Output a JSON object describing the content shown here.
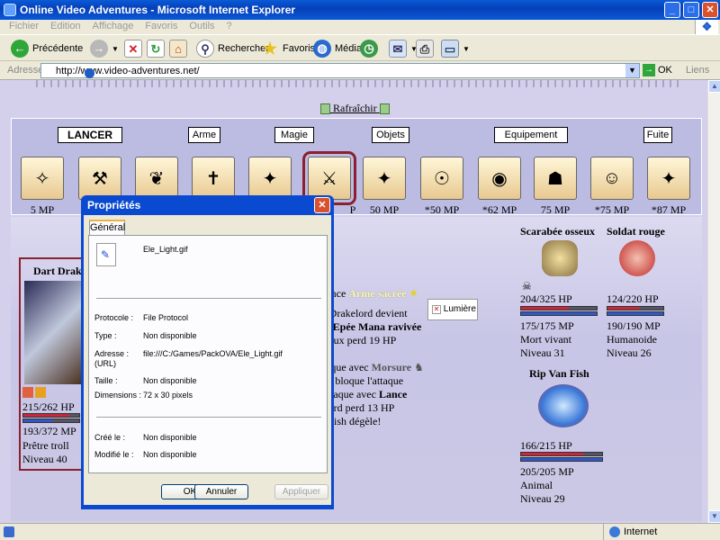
{
  "window": {
    "title": "Online Video Adventures - Microsoft Internet Explorer",
    "min": "_",
    "max": "□",
    "close": "✕"
  },
  "menu": [
    "Fichier",
    "Edition",
    "Affichage",
    "Favoris",
    "Outils",
    "?"
  ],
  "toolbar": {
    "back": "Précédente",
    "search": "Rechercher",
    "favorites": "Favoris",
    "media": "Média"
  },
  "address": {
    "label": "Adresse",
    "url": "http://www.video-adventures.net/",
    "go": "OK",
    "links": "Liens"
  },
  "status": {
    "zone": "Internet"
  },
  "page": {
    "refresh": "Rafraîchir",
    "actions": [
      "LANCER",
      "Arme",
      "Magie",
      "Objets",
      "Equipement",
      "Fuite"
    ],
    "spell_costs": [
      "5 MP",
      "",
      "",
      "",
      "",
      "",
      "50 MP",
      "*50 MP",
      "*62 MP",
      "75 MP",
      "*75 MP",
      "*87 MP"
    ],
    "selected_spell_cost_suffix": "P",
    "spell_icons": [
      "✧",
      "⚒",
      "❦",
      "✝",
      "✦",
      "⚔",
      "✦",
      "☉",
      "◉",
      "☗",
      "☺",
      "✦"
    ],
    "selected_spell": 5,
    "log": {
      "line1_pre": "d lance ",
      "line1_spell": "Arme sacrée",
      "line2": "art Drakelord devient",
      "line3_pre": "vec ",
      "line3_status": "Epée Mana ravivée",
      "line4": "osseux perd 19 HP",
      "line5_pre": "attaque avec ",
      "line5_spell": "Morsure",
      "line6": "lord bloque l'attaque",
      "line7_pre": "e attaque avec ",
      "line7_spell": "Lance",
      "line8": "kelord perd 13 HP",
      "line9": "an Fish dégèle!"
    },
    "light_tooltip": "Lumière",
    "hero": {
      "name": "Dart Drak",
      "hp": "215/262 HP",
      "hp_frac": 0.82,
      "mp": "193/372 MP",
      "mp_frac": 0.52,
      "class": "Prêtre troll",
      "level": "Niveau 40"
    },
    "enemies": [
      {
        "name": "Scarabée osseux",
        "hp": "204/325 HP",
        "hp_frac": 0.63,
        "mp": "175/175 MP",
        "mp_frac": 1.0,
        "type": "Mort vivant",
        "level": "Niveau 31"
      },
      {
        "name": "Soldat rouge",
        "hp": "124/220 HP",
        "hp_frac": 0.56,
        "mp": "190/190 MP",
        "mp_frac": 1.0,
        "type": "Humanoide",
        "level": "Niveau 26"
      },
      {
        "name": "Rip Van Fish",
        "hp": "166/215 HP",
        "hp_frac": 0.77,
        "mp": "205/205 MP",
        "mp_frac": 1.0,
        "type": "Animal",
        "level": "Niveau 29"
      }
    ]
  },
  "dialog": {
    "title": "Propriétés",
    "tab": "Général",
    "filename": "Ele_Light.gif",
    "rows": [
      {
        "label": "Protocole :",
        "value": "File Protocol"
      },
      {
        "label": "Type :",
        "value": "Non disponible"
      },
      {
        "label": "Adresse :",
        "label2": "(URL)",
        "value": "file:///C:/Games/PackOVA/Ele_Light.gif"
      },
      {
        "label": "Taille :",
        "value": "Non disponible"
      },
      {
        "label": "Dimensions :",
        "value": "72  x  30  pixels"
      },
      {
        "label": "Créé le :",
        "value": "Non disponible"
      },
      {
        "label": "Modifié le :",
        "value": "Non disponible"
      }
    ],
    "ok": "OK",
    "cancel": "Annuler",
    "apply": "Appliquer"
  },
  "colors": {
    "hp": "#c8283c",
    "mp": "#3058c8",
    "titlebar": "#0a4ad0"
  }
}
